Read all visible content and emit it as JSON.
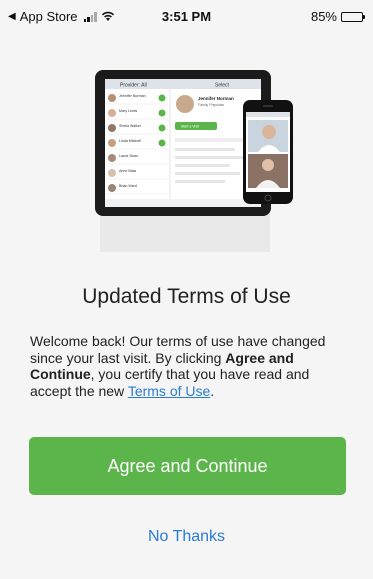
{
  "status_bar": {
    "back_app": "App Store",
    "time": "3:51 PM",
    "battery": "85%",
    "battery_level": 0.85
  },
  "hero": {
    "image_label": "devices-illustration",
    "tablet": {
      "header_left": "Provider: All",
      "header_right": "Select",
      "doctor_name": "Jennifer Norman",
      "doctor_title": "Family Physician",
      "action": "Start a Visit",
      "list_names": [
        "Jennifer Norman",
        "Mary Lewis",
        "Shelia Walker",
        "Linda Mitchell",
        "Laura Sloan",
        "Anne Blais",
        "Brian Ward"
      ]
    },
    "phone": {}
  },
  "content": {
    "title": "Updated Terms of Use",
    "desc_part1": "Welcome back! Our terms of use have changed since your last visit. By clicking ",
    "desc_bold": "Agree and Continue",
    "desc_part2": ", you certify that you have read and accept the new ",
    "desc_link": "Terms of Use",
    "desc_end": "."
  },
  "buttons": {
    "agree": "Agree and Continue",
    "no_thanks": "No Thanks"
  },
  "colors": {
    "accent_green": "#5cb54b",
    "link_blue": "#2a7bd6",
    "background": "#f5f5f5"
  }
}
